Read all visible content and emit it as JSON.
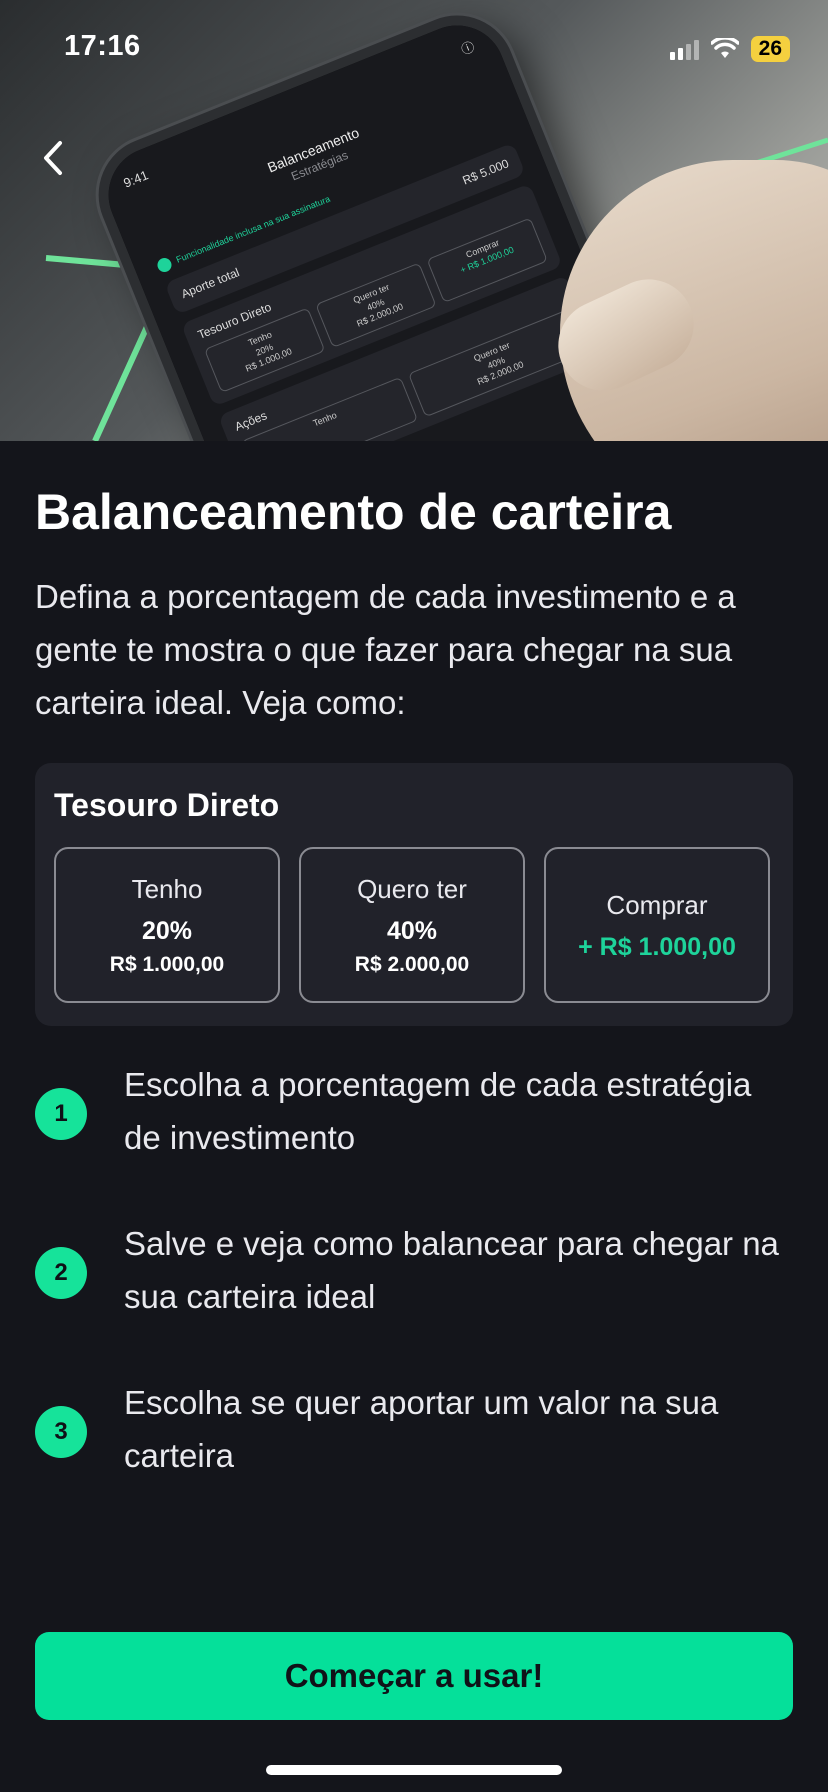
{
  "status_bar": {
    "time": "17:16",
    "battery": "26"
  },
  "hero": {
    "phone": {
      "time": "9:41",
      "title": "Balanceamento",
      "subtitle": "Estratégias",
      "feature_note": "Funcionalidade inclusa na sua assinatura",
      "total_label": "Aporte total",
      "total_value": "R$ 5.000",
      "group1": "Tesouro Direto",
      "g1_have_label": "Tenho",
      "g1_have_pct": "20%",
      "g1_have_val": "R$ 1.000,00",
      "g1_want_label": "Quero ter",
      "g1_want_pct": "40%",
      "g1_want_val": "R$ 2.000,00",
      "g1_buy_label": "Comprar",
      "g1_buy_val": "+ R$ 1.000,00",
      "group2": "Ações",
      "g2_have_label": "Tenho",
      "g2_want_label": "Quero ter",
      "g2_want_pct": "40%",
      "g2_want_val": "R$ 2.000,00"
    }
  },
  "main": {
    "title": "Balanceamento de carteira",
    "description": "Defina a porcentagem de cada investimento e a gente te mostra o que fazer para chegar na sua carteira ideal. Veja como:"
  },
  "example_card": {
    "title": "Tesouro Direto",
    "have": {
      "label": "Tenho",
      "percent": "20%",
      "value": "R$ 1.000,00"
    },
    "want": {
      "label": "Quero ter",
      "percent": "40%",
      "value": "R$ 2.000,00"
    },
    "buy": {
      "label": "Comprar",
      "value": "+ R$ 1.000,00"
    }
  },
  "steps": [
    {
      "number": "1",
      "text": "Escolha a porcentagem de cada estratégia de investimento"
    },
    {
      "number": "2",
      "text": "Salve e veja como balancear para chegar na sua carteira ideal"
    },
    {
      "number": "3",
      "text": "Escolha se quer aportar um valor na sua carteira"
    }
  ],
  "cta": {
    "label": "Começar a usar!"
  },
  "colors": {
    "background": "#14151b",
    "card": "#21222a",
    "accent": "#05e09a",
    "accent_text": "#1ed39a",
    "battery": "#f4d03f"
  },
  "icons": {
    "back": "chevron-left-icon",
    "signal": "cellular-signal-icon",
    "wifi": "wifi-icon",
    "battery": "battery-icon"
  }
}
